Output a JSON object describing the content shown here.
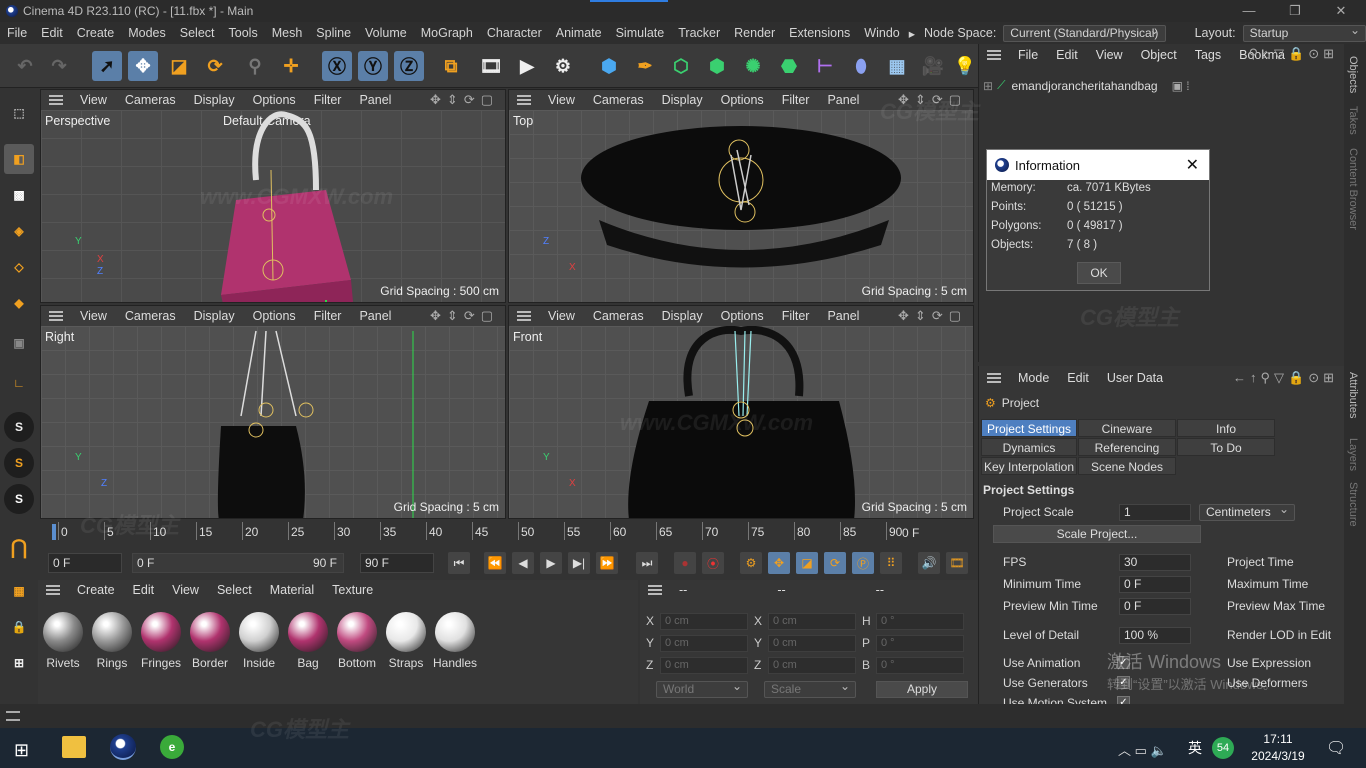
{
  "window": {
    "title": "Cinema 4D R23.110 (RC) - [11.fbx *] - Main"
  },
  "menu": {
    "items": [
      "File",
      "Edit",
      "Create",
      "Modes",
      "Select",
      "Tools",
      "Mesh",
      "Spline",
      "Volume",
      "MoGraph",
      "Character",
      "Animate",
      "Simulate",
      "Tracker",
      "Render",
      "Extensions",
      "Windo"
    ],
    "node_space_label": "Node Space:",
    "node_space_value": "Current (Standard/Physical)",
    "layout_label": "Layout:",
    "layout_value": "Startup"
  },
  "viewport_menu": [
    "View",
    "Cameras",
    "Display",
    "Options",
    "Filter",
    "Panel"
  ],
  "viewports": {
    "perspective": {
      "name": "Perspective",
      "camera": "Default Camera",
      "grid": "Grid Spacing : 500 cm"
    },
    "top": {
      "name": "Top",
      "grid": "Grid Spacing : 5 cm"
    },
    "right": {
      "name": "Right",
      "grid": "Grid Spacing : 5 cm"
    },
    "front": {
      "name": "Front",
      "grid": "Grid Spacing : 5 cm"
    }
  },
  "timeline": {
    "ticks": [
      "0",
      "5",
      "10",
      "15",
      "20",
      "25",
      "30",
      "35",
      "40",
      "45",
      "50",
      "55",
      "60",
      "65",
      "70",
      "75",
      "80",
      "85",
      "90"
    ],
    "end_label": "0 F",
    "current_frame": "0 F",
    "min_frame": "0 F",
    "max_frame": "90 F",
    "preview_end": "90 F"
  },
  "material_menu": [
    "Create",
    "Edit",
    "View",
    "Select",
    "Material",
    "Texture"
  ],
  "materials": [
    {
      "name": "Rivets",
      "color": "#8a8a8a"
    },
    {
      "name": "Rings",
      "color": "#9a9a9a"
    },
    {
      "name": "Fringes",
      "color": "#b0336e"
    },
    {
      "name": "Border",
      "color": "#b0336e"
    },
    {
      "name": "Inside",
      "color": "#d0d0d0"
    },
    {
      "name": "Bag",
      "color": "#b0336e"
    },
    {
      "name": "Bottom",
      "color": "#c04a80"
    },
    {
      "name": "Straps",
      "color": "#e8e8e8"
    },
    {
      "name": "Handles",
      "color": "#e0e0e0"
    }
  ],
  "coords": {
    "header": [
      "--",
      "--",
      "--"
    ],
    "rows": [
      {
        "a": "X",
        "av": "0 cm",
        "b": "X",
        "bv": "0 cm",
        "c": "H",
        "cv": "0 °"
      },
      {
        "a": "Y",
        "av": "0 cm",
        "b": "Y",
        "bv": "0 cm",
        "c": "P",
        "cv": "0 °"
      },
      {
        "a": "Z",
        "av": "0 cm",
        "b": "Z",
        "bv": "0 cm",
        "c": "B",
        "cv": "0 °"
      }
    ],
    "world": "World",
    "scale": "Scale",
    "apply": "Apply"
  },
  "object_manager": {
    "menu": [
      "File",
      "Edit",
      "View",
      "Object",
      "Tags",
      "Bookma"
    ],
    "object_name": "emandjorancheritahandbag"
  },
  "info_dialog": {
    "title": "Information",
    "rows": [
      {
        "label": "Memory:",
        "value": "ca. 7071 KBytes"
      },
      {
        "label": "Points:",
        "value": "0 ( 51215 )"
      },
      {
        "label": "Polygons:",
        "value": "0 ( 49817 )"
      },
      {
        "label": "Objects:",
        "value": "7 ( 8 )"
      }
    ],
    "ok": "OK"
  },
  "attributes": {
    "menu": [
      "Mode",
      "Edit",
      "User Data"
    ],
    "object": "Project",
    "tabs": [
      "Project Settings",
      "Cineware",
      "Info",
      "Dynamics",
      "Referencing",
      "To Do",
      "Key Interpolation",
      "Scene Nodes"
    ],
    "section": "Project Settings",
    "project_scale_label": "Project Scale",
    "project_scale_value": "1",
    "units": "Centimeters",
    "scale_button": "Scale Project...",
    "fps_label": "FPS",
    "fps_value": "30",
    "project_time_label": "Project Time",
    "min_time_label": "Minimum Time",
    "min_time_value": "0 F",
    "max_time_label": "Maximum Time",
    "prev_min_label": "Preview Min Time",
    "prev_min_value": "0 F",
    "prev_max_label": "Preview Max Time",
    "lod_label": "Level of Detail",
    "lod_value": "100 %",
    "render_lod_label": "Render LOD in Edit",
    "use_animation": "Use Animation",
    "use_expression": "Use Expression",
    "use_generators": "Use Generators",
    "use_deformers": "Use Deformers",
    "use_motion": "Use Motion System"
  },
  "right_tabs": [
    "Objects",
    "Takes",
    "Content Browser",
    "Attributes",
    "Layers",
    "Structure"
  ],
  "activation": {
    "line1": "激活 Windows",
    "line2": "转到“设置”以激活 Windows。"
  },
  "watermark": {
    "brand": "CG模型主",
    "url": "www.CGMXW.com"
  },
  "taskbar": {
    "ime": "英",
    "badge": "54",
    "time": "17:11",
    "date": "2024/3/19"
  }
}
